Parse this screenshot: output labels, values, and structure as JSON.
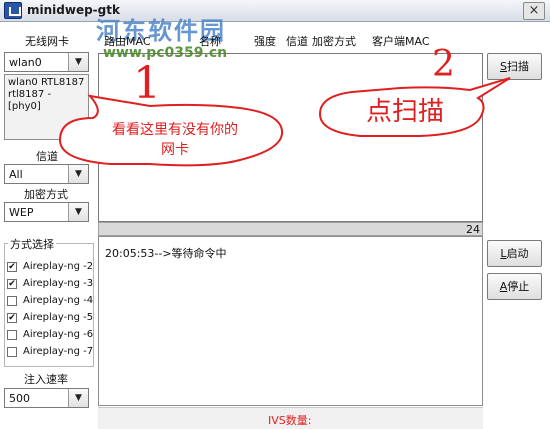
{
  "window": {
    "title": "minidwep-gtk",
    "close_glyph": "×"
  },
  "watermark": {
    "site_name": "河东软件园",
    "url": "www.pc0359.cn"
  },
  "sidebar": {
    "nic_label": "无线网卡",
    "nic_selected": "wlan0",
    "nic_info": [
      "wlan0 RTL8187",
      "rtl8187 - [phy0]"
    ],
    "channel_label": "信道",
    "channel_selected": "All",
    "encryption_label": "加密方式",
    "encryption_selected": "WEP",
    "mode_label": "方式选择",
    "modes": [
      {
        "label": "Aireplay-ng -2",
        "checked": true
      },
      {
        "label": "Aireplay-ng -3",
        "checked": true
      },
      {
        "label": "Aireplay-ng -4",
        "checked": false
      },
      {
        "label": "Aireplay-ng -5",
        "checked": true
      },
      {
        "label": "Aireplay-ng -6",
        "checked": false
      },
      {
        "label": "Aireplay-ng -7",
        "checked": false
      }
    ],
    "rate_label": "注入速率",
    "rate_selected": "500"
  },
  "table": {
    "columns": [
      "路由MAC",
      "名称",
      "强度",
      "信道",
      "加密方式",
      "客户端MAC"
    ]
  },
  "divider": {
    "count": "24"
  },
  "log": {
    "lines": [
      "20:05:53-->等待命令中"
    ]
  },
  "status": {
    "ivs_label": "IVS数量:"
  },
  "buttons": {
    "scan_key": "S",
    "scan_rest": "扫描",
    "start_key": "L",
    "start_rest": "启动",
    "stop_key": "A",
    "stop_rest": "停止"
  },
  "annotations": {
    "number_1": "1",
    "bubble_1": [
      "看看这里有没有你的",
      "网卡"
    ],
    "number_2": "2",
    "bubble_2": "点扫描",
    "color": "#e02020"
  },
  "icons": {
    "dropdown_arrow": "▼",
    "check_mark": "✔",
    "app_icon": "app-icon"
  }
}
